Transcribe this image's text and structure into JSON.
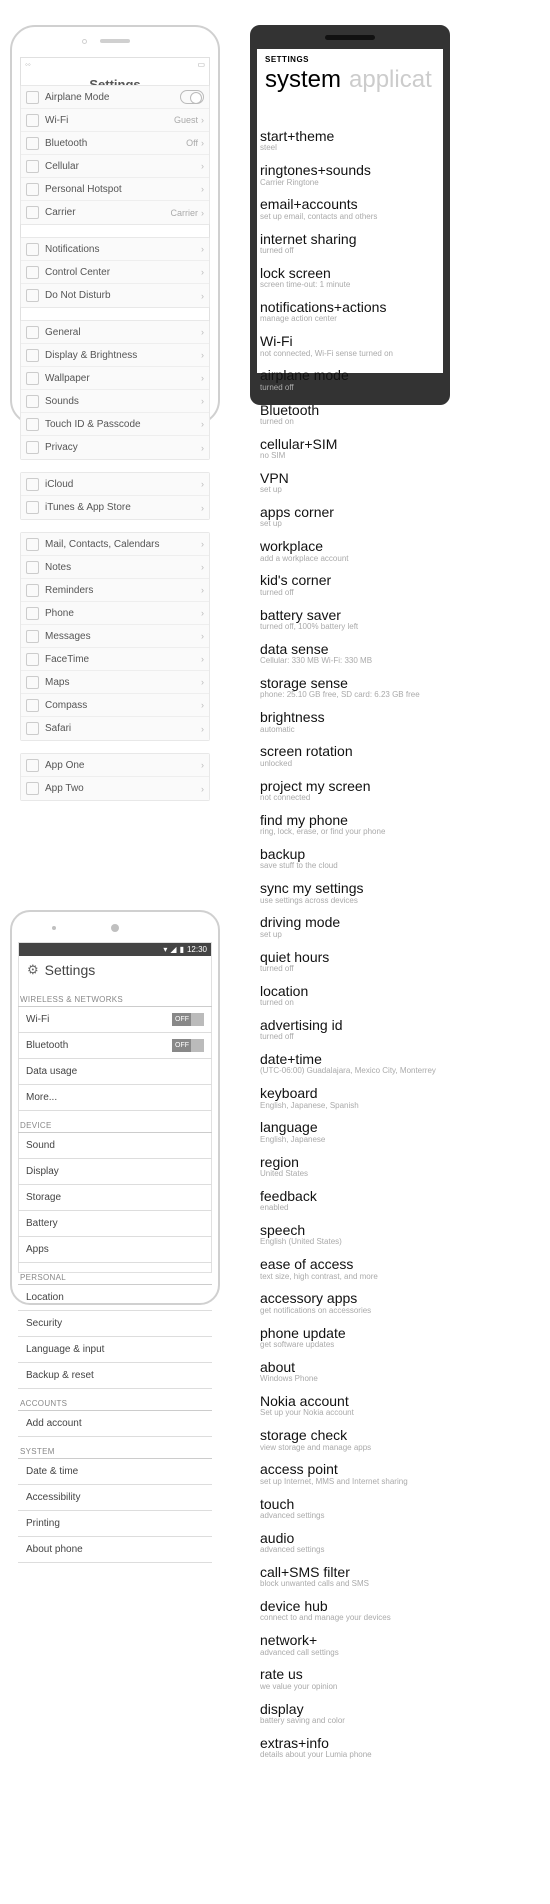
{
  "ios": {
    "title": "Settings",
    "groups": [
      [
        {
          "label": "Airplane Mode",
          "toggle": true
        },
        {
          "label": "Wi-Fi",
          "value": "Guest"
        },
        {
          "label": "Bluetooth",
          "value": "Off"
        },
        {
          "label": "Cellular"
        },
        {
          "label": "Personal Hotspot"
        },
        {
          "label": "Carrier",
          "value": "Carrier"
        }
      ],
      [
        {
          "label": "Notifications"
        },
        {
          "label": "Control Center"
        },
        {
          "label": "Do Not Disturb"
        }
      ],
      [
        {
          "label": "General"
        },
        {
          "label": "Display & Brightness"
        },
        {
          "label": "Wallpaper"
        },
        {
          "label": "Sounds"
        },
        {
          "label": "Touch ID & Passcode"
        },
        {
          "label": "Privacy"
        }
      ],
      [
        {
          "label": "iCloud"
        },
        {
          "label": "iTunes & App Store"
        }
      ],
      [
        {
          "label": "Mail, Contacts, Calendars"
        },
        {
          "label": "Notes"
        },
        {
          "label": "Reminders"
        },
        {
          "label": "Phone"
        },
        {
          "label": "Messages"
        },
        {
          "label": "FaceTime"
        },
        {
          "label": "Maps"
        },
        {
          "label": "Compass"
        },
        {
          "label": "Safari"
        }
      ],
      [
        {
          "label": "App One"
        },
        {
          "label": "App Two"
        }
      ]
    ]
  },
  "android": {
    "time": "12:30",
    "title": "Settings",
    "sections": [
      {
        "header": "WIRELESS & NETWORKS",
        "items": [
          {
            "label": "Wi-Fi",
            "toggle": "OFF"
          },
          {
            "label": "Bluetooth",
            "toggle": "OFF"
          },
          {
            "label": "Data usage"
          },
          {
            "label": "More..."
          }
        ]
      },
      {
        "header": "DEVICE",
        "items": [
          {
            "label": "Sound"
          },
          {
            "label": "Display"
          },
          {
            "label": "Storage"
          },
          {
            "label": "Battery"
          },
          {
            "label": "Apps"
          }
        ]
      },
      {
        "header": "PERSONAL",
        "items": [
          {
            "label": "Location"
          },
          {
            "label": "Security"
          },
          {
            "label": "Language & input"
          },
          {
            "label": "Backup & reset"
          }
        ]
      },
      {
        "header": "ACCOUNTS",
        "items": [
          {
            "label": "Add account"
          }
        ]
      },
      {
        "header": "SYSTEM",
        "items": [
          {
            "label": "Date & time"
          },
          {
            "label": "Accessibility"
          },
          {
            "label": "Printing"
          },
          {
            "label": "About phone"
          }
        ]
      }
    ]
  },
  "wp": {
    "header": "SETTINGS",
    "tab_active": "system",
    "tab_inactive": "applicat",
    "items": [
      {
        "label": "start+theme",
        "sub": "steel"
      },
      {
        "label": "ringtones+sounds",
        "sub": "Carrier Ringtone"
      },
      {
        "label": "email+accounts",
        "sub": "set up email, contacts and others"
      },
      {
        "label": "internet sharing",
        "sub": "turned off"
      },
      {
        "label": "lock screen",
        "sub": "screen time-out: 1 minute"
      },
      {
        "label": "notifications+actions",
        "sub": "manage action center"
      },
      {
        "label": "Wi-Fi",
        "sub": "not connected, Wi-Fi sense turned on"
      },
      {
        "label": "airplane mode",
        "sub": "turned off"
      },
      {
        "label": "Bluetooth",
        "sub": "turned on"
      },
      {
        "label": "cellular+SIM",
        "sub": "no SIM"
      },
      {
        "label": "VPN",
        "sub": "set up"
      },
      {
        "label": "apps corner",
        "sub": "set up"
      },
      {
        "label": "workplace",
        "sub": "add a workplace account"
      },
      {
        "label": "kid's corner",
        "sub": "turned off"
      },
      {
        "label": "battery saver",
        "sub": "turned off, 100% battery left"
      },
      {
        "label": "data sense",
        "sub": "Cellular: 330 MB Wi-Fi: 330 MB"
      },
      {
        "label": "storage sense",
        "sub": "phone: 25.10 GB free, SD card: 6.23 GB free"
      },
      {
        "label": "brightness",
        "sub": "automatic"
      },
      {
        "label": "screen rotation",
        "sub": "unlocked"
      },
      {
        "label": "project my screen",
        "sub": "not connected"
      },
      {
        "label": "find my phone",
        "sub": "ring, lock, erase, or find your phone"
      },
      {
        "label": "backup",
        "sub": "save stuff to the cloud"
      },
      {
        "label": "sync my settings",
        "sub": "use settings across devices"
      },
      {
        "label": "driving mode",
        "sub": "set up"
      },
      {
        "label": "quiet hours",
        "sub": "turned off"
      },
      {
        "label": "location",
        "sub": "turned on"
      },
      {
        "label": "advertising id",
        "sub": "turned off"
      },
      {
        "label": "date+time",
        "sub": "(UTC-06:00) Guadalajara, Mexico City, Monterrey"
      },
      {
        "label": "keyboard",
        "sub": "English, Japanese, Spanish"
      },
      {
        "label": "language",
        "sub": "English, Japanese"
      },
      {
        "label": "region",
        "sub": "United States"
      },
      {
        "label": "feedback",
        "sub": "enabled"
      },
      {
        "label": "speech",
        "sub": "English (United States)"
      },
      {
        "label": "ease of access",
        "sub": "text size, high contrast, and more"
      },
      {
        "label": "accessory apps",
        "sub": "get notifications on accessories"
      },
      {
        "label": "phone update",
        "sub": "get software updates"
      },
      {
        "label": "about",
        "sub": "Windows Phone"
      },
      {
        "label": "Nokia account",
        "sub": "Set up your Nokia account"
      },
      {
        "label": "storage check",
        "sub": "view storage and manage apps"
      },
      {
        "label": "access point",
        "sub": "set up Internet, MMS and Internet sharing"
      },
      {
        "label": "touch",
        "sub": "advanced settings"
      },
      {
        "label": "audio",
        "sub": "advanced settings"
      },
      {
        "label": "call+SMS filter",
        "sub": "block unwanted calls and SMS"
      },
      {
        "label": "device hub",
        "sub": "connect to and manage your devices"
      },
      {
        "label": "network+",
        "sub": "advanced call settings"
      },
      {
        "label": "rate us",
        "sub": "we value your opinion"
      },
      {
        "label": "display",
        "sub": "battery saving and color"
      },
      {
        "label": "extras+info",
        "sub": "details about your Lumia phone"
      }
    ]
  }
}
